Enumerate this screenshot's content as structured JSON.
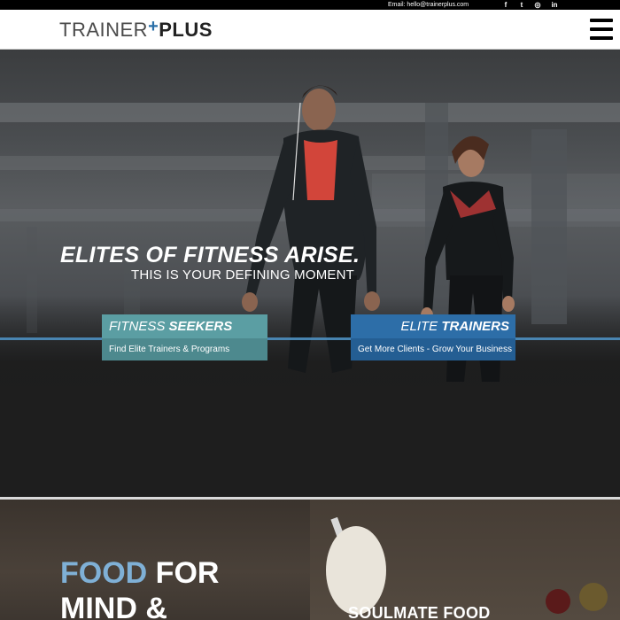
{
  "topbar": {
    "email": "Email: hello@trainerplus.com",
    "social": [
      {
        "name": "facebook-icon",
        "glyph": "f"
      },
      {
        "name": "twitter-icon",
        "glyph": "t"
      },
      {
        "name": "instagram-icon",
        "glyph": "◎"
      },
      {
        "name": "linkedin-icon",
        "glyph": "in"
      }
    ]
  },
  "header": {
    "logo_part1": "TRAINER",
    "logo_plus": "+",
    "logo_part2": "PLUS"
  },
  "hero": {
    "title": "ELITES OF FITNESS ARISE.",
    "subtitle": "THIS IS YOUR DEFINING MOMENT",
    "cards": {
      "seekers": {
        "word1": "FITNESS",
        "word2": "SEEKERS",
        "sub": "Find Elite Trainers & Programs"
      },
      "trainers": {
        "word1": "ELITE",
        "word2": "TRAINERS",
        "sub": "Get More Clients - Grow Your Business"
      }
    }
  },
  "food": {
    "title_word1": "FOOD",
    "title_word2": "FOR",
    "title_line2": "MIND &",
    "card_title": "SOULMATE FOOD"
  },
  "colors": {
    "accent_blue": "#2d6ea8",
    "teal": "#5b9ea3",
    "light_blue": "#7fb0d6"
  }
}
